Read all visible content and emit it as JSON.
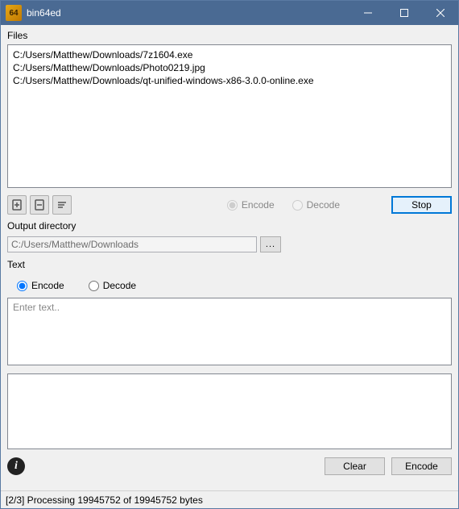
{
  "window": {
    "title": "bin64ed",
    "icon_text": "64"
  },
  "files": {
    "label": "Files",
    "items": [
      "C:/Users/Matthew/Downloads/7z1604.exe",
      "C:/Users/Matthew/Downloads/Photo0219.jpg",
      "C:/Users/Matthew/Downloads/qt-unified-windows-x86-3.0.0-online.exe"
    ]
  },
  "file_mode": {
    "encode": "Encode",
    "decode": "Decode",
    "selected": "encode"
  },
  "stop_label": "Stop",
  "output": {
    "label": "Output directory",
    "value": "C:/Users/Matthew/Downloads",
    "browse": "..."
  },
  "text_section": {
    "label": "Text",
    "encode": "Encode",
    "decode": "Decode",
    "selected": "encode",
    "input_placeholder": "Enter text..",
    "input_value": "",
    "output_value": ""
  },
  "buttons": {
    "clear": "Clear",
    "encode": "Encode"
  },
  "status": "[2/3] Processing 19945752 of 19945752 bytes"
}
